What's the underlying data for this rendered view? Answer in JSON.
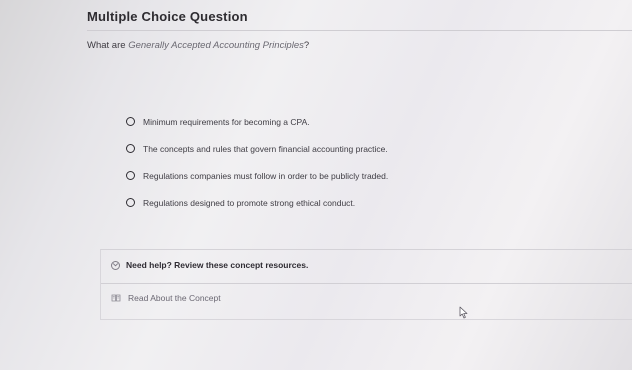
{
  "header": {
    "title": "Multiple Choice Question"
  },
  "question": {
    "prefix": "What are ",
    "highlight": "Generally Accepted Accounting Principles",
    "suffix": "?"
  },
  "options": [
    {
      "label": "Minimum requirements for becoming a CPA."
    },
    {
      "label": "The concepts and rules that govern financial accounting practice."
    },
    {
      "label": "Regulations companies must follow in order to be publicly traded."
    },
    {
      "label": "Regulations designed to promote strong ethical conduct."
    }
  ],
  "help": {
    "toggle_label": "Need help? Review these concept resources.",
    "resource_label": "Read About the Concept"
  },
  "icons": {
    "help_toggle": "chevron-down-circle-icon",
    "resource": "book-icon",
    "cursor": "mouse-pointer-icon"
  }
}
